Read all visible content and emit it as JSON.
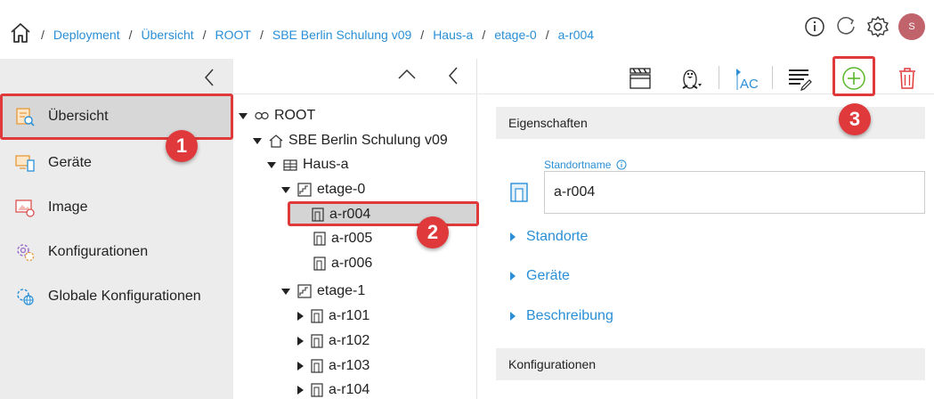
{
  "breadcrumb": {
    "separator": "/",
    "items": [
      "Deployment",
      "Übersicht",
      "ROOT",
      "SBE Berlin Schulung v09",
      "Haus-a",
      "etage-0",
      "a-r004"
    ]
  },
  "header": {
    "avatar_initial": "S",
    "icons": [
      "info-icon",
      "refresh-icon",
      "gear-icon"
    ]
  },
  "sidebar": {
    "items": [
      {
        "label": "Übersicht",
        "icon": "overview-icon",
        "active": true
      },
      {
        "label": "Geräte",
        "icon": "devices-icon"
      },
      {
        "label": "Image",
        "icon": "image-icon"
      },
      {
        "label": "Konfigurationen",
        "icon": "configurations-icon"
      },
      {
        "label": "Globale Konfigurationen",
        "icon": "global-configurations-icon"
      }
    ]
  },
  "tree": {
    "nodes": [
      {
        "label": "ROOT",
        "icon": "root-icon",
        "expanded": true
      },
      {
        "label": "SBE Berlin Schulung v09",
        "icon": "home-icon",
        "expanded": true
      },
      {
        "label": "Haus-a",
        "icon": "building-icon",
        "expanded": true
      },
      {
        "label": "etage-0",
        "icon": "floor-icon",
        "expanded": true
      },
      {
        "label": "a-r004",
        "icon": "room-icon",
        "selected": true
      },
      {
        "label": "a-r005",
        "icon": "room-icon"
      },
      {
        "label": "a-r006",
        "icon": "room-icon"
      },
      {
        "label": "etage-1",
        "icon": "floor-icon",
        "expanded": true
      },
      {
        "label": "a-r101",
        "icon": "room-icon",
        "collapsed": true
      },
      {
        "label": "a-r102",
        "icon": "room-icon",
        "collapsed": true
      },
      {
        "label": "a-r103",
        "icon": "room-icon",
        "collapsed": true
      },
      {
        "label": "a-r104",
        "icon": "room-icon",
        "collapsed": true
      }
    ]
  },
  "toolbar": {
    "icons": [
      "clapperboard-icon",
      "linux-icon",
      "text-ac-icon",
      "list-edit-icon",
      "add-icon",
      "delete-icon"
    ],
    "ac_text": "AC"
  },
  "details": {
    "properties_title": "Eigenschaften",
    "field_label": "Standortname",
    "field_value": "a-r004",
    "expanders": [
      "Standorte",
      "Geräte",
      "Beschreibung"
    ],
    "configurations_title": "Konfigurationen"
  },
  "annotations": [
    "1",
    "2",
    "3"
  ],
  "colors": {
    "accent": "#2a8fd6",
    "annotation": "#e0393b",
    "add": "#5cb82e",
    "delete": "#e0393b",
    "avatar": "#c0636b"
  }
}
